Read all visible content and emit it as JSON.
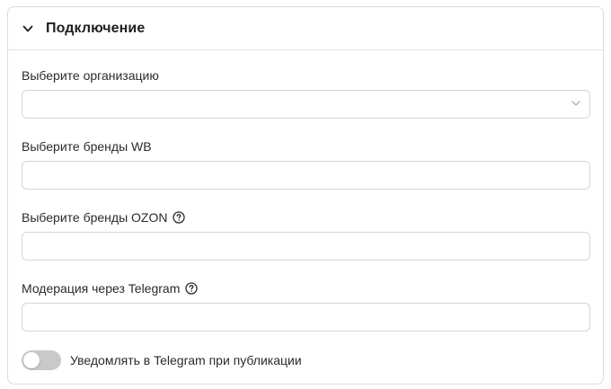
{
  "section": {
    "title": "Подключение",
    "expanded": true
  },
  "fields": {
    "organization": {
      "label": "Выберите организацию",
      "value": "",
      "placeholder": ""
    },
    "brands_wb": {
      "label": "Выберите бренды WB",
      "value": "",
      "placeholder": ""
    },
    "brands_ozon": {
      "label": "Выберите бренды OZON",
      "value": "",
      "placeholder": ""
    },
    "telegram_moderation": {
      "label": "Модерация через Telegram",
      "value": "",
      "placeholder": ""
    }
  },
  "notify_toggle": {
    "label": "Уведомлять в Telegram при публикации",
    "enabled": false
  },
  "colors": {
    "border": "#dcdcdc",
    "toggle_off": "#c9c9c9"
  }
}
